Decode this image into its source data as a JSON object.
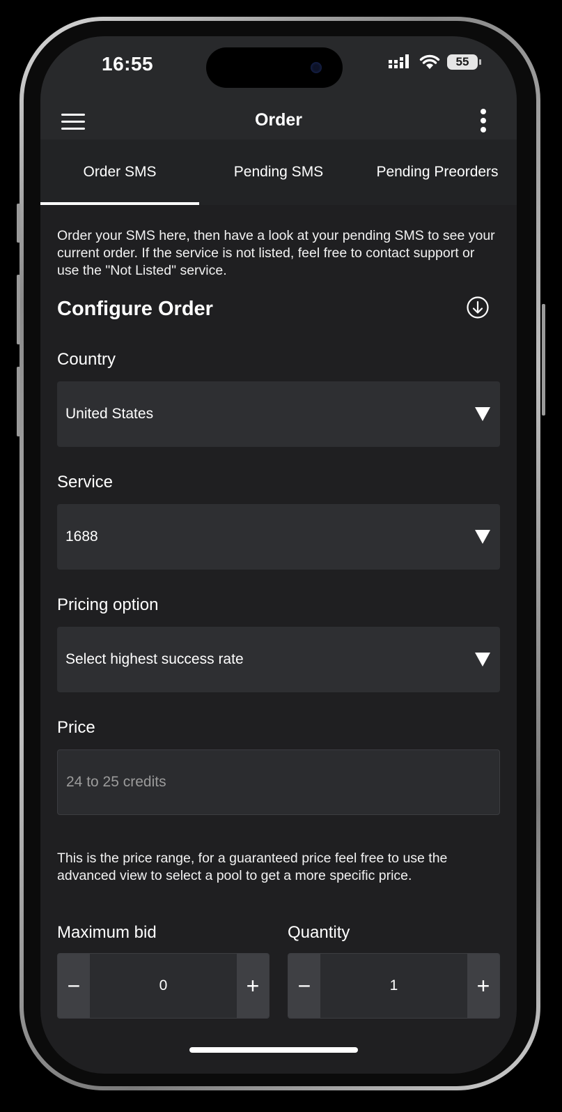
{
  "status_bar": {
    "time": "16:55",
    "battery": "55"
  },
  "app_bar": {
    "title": "Order"
  },
  "tabs": [
    {
      "label": "Order SMS",
      "active": true
    },
    {
      "label": "Pending SMS",
      "active": false
    },
    {
      "label": "Pending Preorders",
      "active": false
    }
  ],
  "intro_text": "Order your SMS here, then have a look at your pending SMS to see your current order. If the service is not listed, feel free to contact support or use the \"Not Listed\" service.",
  "configure": {
    "title": "Configure Order"
  },
  "country": {
    "label": "Country",
    "value": "United States"
  },
  "service": {
    "label": "Service",
    "value": "1688"
  },
  "pricing": {
    "label": "Pricing option",
    "value": "Select highest success rate"
  },
  "price": {
    "label": "Price",
    "placeholder": "24 to 25 credits"
  },
  "price_hint": "This is the price range, for a guaranteed price feel free to use the advanced view to select a pool to get a more specific price.",
  "max_bid": {
    "label": "Maximum bid",
    "value": "0",
    "decrement": "−",
    "increment": "+"
  },
  "quantity": {
    "label": "Quantity",
    "value": "1",
    "decrement": "−",
    "increment": "+"
  },
  "colors": {
    "background": "#1f1f21",
    "app_bar": "#28292b",
    "field": "#2e2f32",
    "accent": "#ffffff"
  }
}
